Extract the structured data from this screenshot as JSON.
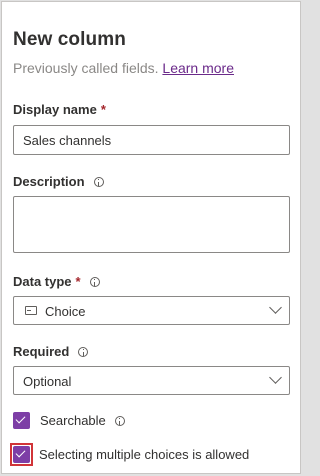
{
  "panel": {
    "title": "New column",
    "subtitle": "Previously called fields.",
    "learn_more": "Learn more"
  },
  "display_name": {
    "label": "Display name",
    "required_mark": "*",
    "value": "Sales channels"
  },
  "description": {
    "label": "Description",
    "value": ""
  },
  "data_type": {
    "label": "Data type",
    "required_mark": "*",
    "value": "Choice",
    "icon": "choice-icon"
  },
  "required": {
    "label": "Required",
    "value": "Optional"
  },
  "searchable": {
    "label": "Searchable",
    "checked": true
  },
  "multi_choice": {
    "label": "Selecting multiple choices is allowed",
    "checked": true
  },
  "colors": {
    "accent": "#7d3ea6",
    "link": "#6b2a8a",
    "required": "#a4262c",
    "highlight": "#d13438"
  }
}
